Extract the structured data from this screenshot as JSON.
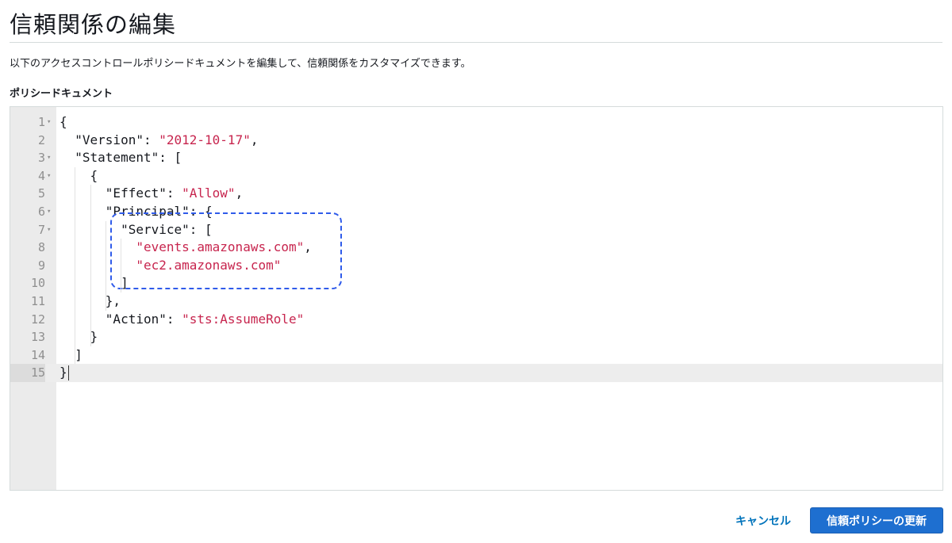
{
  "page": {
    "title": "信頼関係の編集",
    "description": "以下のアクセスコントロールポリシードキュメントを編集して、信頼関係をカスタマイズできます。",
    "section_label": "ポリシードキュメント"
  },
  "editor": {
    "active_line": 15,
    "lines": [
      {
        "n": "1",
        "fold": true,
        "tokens": [
          {
            "t": "{",
            "c": "p"
          }
        ]
      },
      {
        "n": "2",
        "fold": false,
        "tokens": [
          {
            "t": "  ",
            "c": "p"
          },
          {
            "t": "\"Version\"",
            "c": "k"
          },
          {
            "t": ": ",
            "c": "p"
          },
          {
            "t": "\"2012-10-17\"",
            "c": "s"
          },
          {
            "t": ",",
            "c": "p"
          }
        ]
      },
      {
        "n": "3",
        "fold": true,
        "tokens": [
          {
            "t": "  ",
            "c": "p"
          },
          {
            "t": "\"Statement\"",
            "c": "k"
          },
          {
            "t": ": [",
            "c": "p"
          }
        ]
      },
      {
        "n": "4",
        "fold": true,
        "tokens": [
          {
            "t": "    {",
            "c": "p"
          }
        ]
      },
      {
        "n": "5",
        "fold": false,
        "tokens": [
          {
            "t": "      ",
            "c": "p"
          },
          {
            "t": "\"Effect\"",
            "c": "k"
          },
          {
            "t": ": ",
            "c": "p"
          },
          {
            "t": "\"Allow\"",
            "c": "s"
          },
          {
            "t": ",",
            "c": "p"
          }
        ]
      },
      {
        "n": "6",
        "fold": true,
        "tokens": [
          {
            "t": "      ",
            "c": "p"
          },
          {
            "t": "\"Principal\"",
            "c": "k"
          },
          {
            "t": ": {",
            "c": "p"
          }
        ]
      },
      {
        "n": "7",
        "fold": true,
        "tokens": [
          {
            "t": "        ",
            "c": "p"
          },
          {
            "t": "\"Service\"",
            "c": "k"
          },
          {
            "t": ": [",
            "c": "p"
          }
        ]
      },
      {
        "n": "8",
        "fold": false,
        "tokens": [
          {
            "t": "          ",
            "c": "p"
          },
          {
            "t": "\"events.amazonaws.com\"",
            "c": "s"
          },
          {
            "t": ",",
            "c": "p"
          }
        ]
      },
      {
        "n": "9",
        "fold": false,
        "tokens": [
          {
            "t": "          ",
            "c": "p"
          },
          {
            "t": "\"ec2.amazonaws.com\"",
            "c": "s"
          }
        ]
      },
      {
        "n": "10",
        "fold": false,
        "tokens": [
          {
            "t": "        ]",
            "c": "p"
          }
        ]
      },
      {
        "n": "11",
        "fold": false,
        "tokens": [
          {
            "t": "      },",
            "c": "p"
          }
        ]
      },
      {
        "n": "12",
        "fold": false,
        "tokens": [
          {
            "t": "      ",
            "c": "p"
          },
          {
            "t": "\"Action\"",
            "c": "k"
          },
          {
            "t": ": ",
            "c": "p"
          },
          {
            "t": "\"sts:AssumeRole\"",
            "c": "s"
          }
        ]
      },
      {
        "n": "13",
        "fold": false,
        "tokens": [
          {
            "t": "    }",
            "c": "p"
          }
        ]
      },
      {
        "n": "14",
        "fold": false,
        "tokens": [
          {
            "t": "  ]",
            "c": "p"
          }
        ]
      },
      {
        "n": "15",
        "fold": false,
        "tokens": [
          {
            "t": "}",
            "c": "p"
          }
        ]
      }
    ]
  },
  "actions": {
    "cancel_label": "キャンセル",
    "update_label": "信頼ポリシーの更新"
  },
  "colors": {
    "string": "#c7254e",
    "primary_button": "#1e6fd0",
    "link": "#0073bb",
    "highlight_border": "#2f5bea"
  }
}
